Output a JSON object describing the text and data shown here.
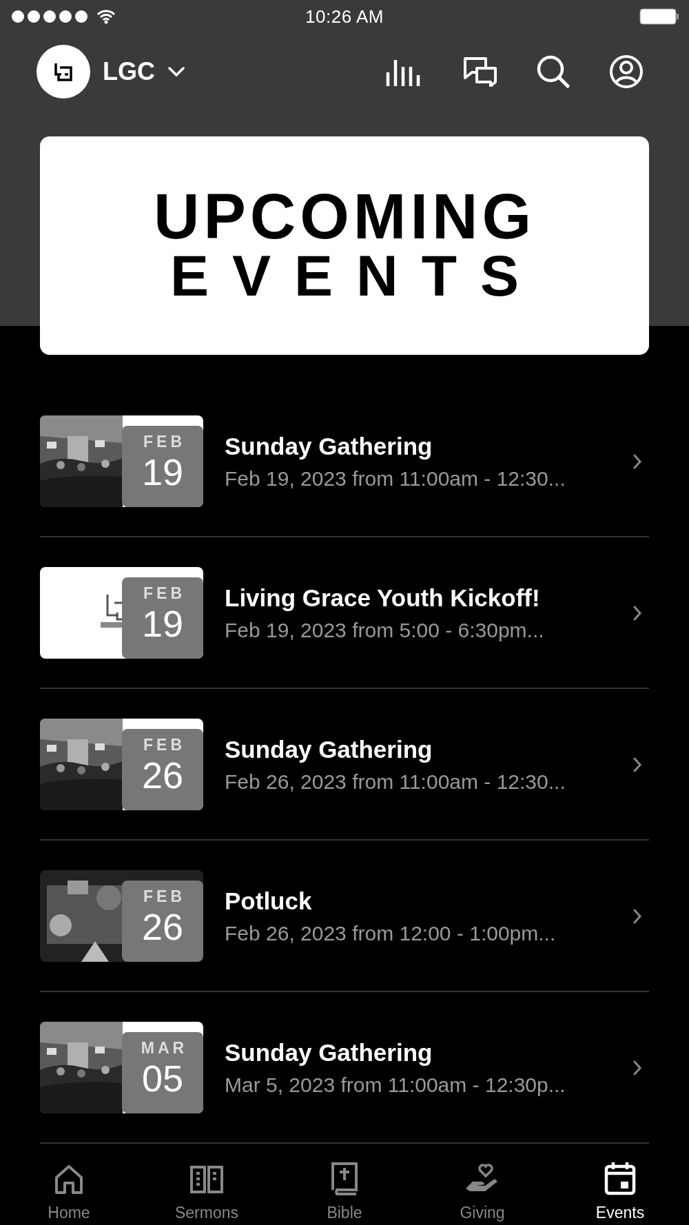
{
  "status_bar": {
    "time": "10:26 AM"
  },
  "header": {
    "church": "LGC"
  },
  "banner": {
    "line_1": "UPCOMING",
    "line_2": "EVENTS"
  },
  "events": [
    {
      "title": "Sunday Gathering",
      "details": "Feb 19, 2023 from 11:00am - 12:30...",
      "month": "FEB",
      "day": "19",
      "thumbnail": {
        "kind": "hall"
      }
    },
    {
      "title": "Living Grace Youth Kickoff!",
      "details": "Feb 19, 2023 from 5:00 - 6:30pm...",
      "month": "FEB",
      "day": "19",
      "thumbnail": {
        "kind": "logo"
      }
    },
    {
      "title": "Sunday Gathering",
      "details": "Feb 26, 2023 from 11:00am - 12:30...",
      "month": "FEB",
      "day": "26",
      "thumbnail": {
        "kind": "hall"
      }
    },
    {
      "title": "Potluck",
      "details": "Feb 26, 2023 from 12:00 - 1:00pm...",
      "month": "FEB",
      "day": "26",
      "thumbnail": {
        "kind": "food"
      }
    },
    {
      "title": "Sunday Gathering",
      "details": "Mar 5, 2023 from 11:00am - 12:30p...",
      "month": "MAR",
      "day": "05",
      "thumbnail": {
        "kind": "hall"
      }
    }
  ],
  "tab_bar": [
    {
      "label": "Home",
      "kind": "home",
      "selected": false
    },
    {
      "label": "Sermons",
      "kind": "sermons",
      "selected": false
    },
    {
      "label": "Bible",
      "kind": "bible",
      "selected": false
    },
    {
      "label": "Giving",
      "kind": "giving",
      "selected": false
    },
    {
      "label": "Events",
      "kind": "events",
      "selected": true
    }
  ]
}
